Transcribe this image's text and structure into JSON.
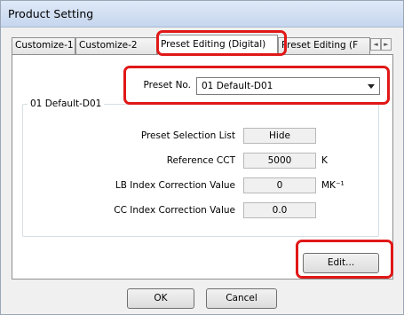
{
  "window": {
    "title": "Product Setting"
  },
  "tabs": [
    {
      "label": "Customize-1"
    },
    {
      "label": "Customize-2"
    },
    {
      "label": "Preset Editing (Digital)"
    },
    {
      "label": "Preset Editing (F"
    }
  ],
  "tab_scroll": {
    "left": "◄",
    "right": "►"
  },
  "preset": {
    "label": "Preset No.",
    "value": "01 Default-D01"
  },
  "group": {
    "title": "01 Default-D01",
    "rows": [
      {
        "label": "Preset Selection List",
        "value": "Hide",
        "unit": ""
      },
      {
        "label": "Reference CCT",
        "value": "5000",
        "unit": "K"
      },
      {
        "label": "LB Index Correction Value",
        "value": "0",
        "unit": "MK⁻¹"
      },
      {
        "label": "CC Index Correction Value",
        "value": "0.0",
        "unit": ""
      }
    ]
  },
  "buttons": {
    "edit": "Edit...",
    "ok": "OK",
    "cancel": "Cancel"
  },
  "colors": {
    "highlight": "#e01818",
    "title_bar": "#cfdcf0"
  }
}
